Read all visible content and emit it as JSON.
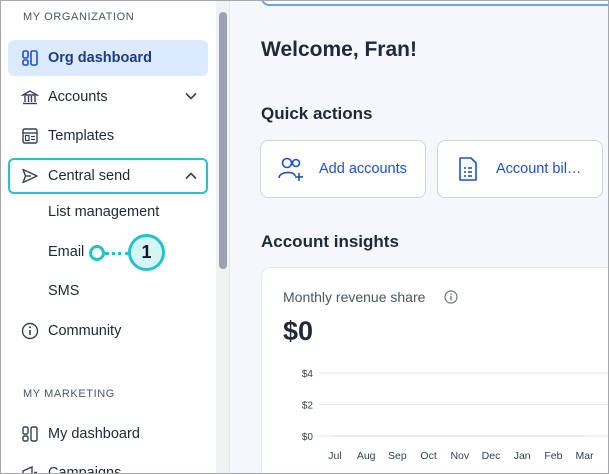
{
  "sidebar": {
    "section1": "MY ORGANIZATION",
    "org_dashboard": "Org dashboard",
    "accounts": "Accounts",
    "templates": "Templates",
    "central_send": "Central send",
    "list_management": "List management",
    "email": "Email",
    "sms": "SMS",
    "community": "Community",
    "section2": "MY MARKETING",
    "my_dashboard": "My dashboard",
    "campaigns": "Campaigns"
  },
  "main": {
    "welcome": "Welcome, Fran!",
    "quick_actions": "Quick actions",
    "add_accounts": "Add accounts",
    "account_billing": "Account bil…",
    "account_insights": "Account insights",
    "monthly_revenue": "Monthly revenue share",
    "revenue_value": "$0"
  },
  "callout": {
    "number": "1"
  },
  "colors": {
    "accent": "#22c3c9",
    "active_bg": "#dbeafe",
    "link": "#1d4ed8"
  },
  "chart_data": {
    "type": "line",
    "categories": [
      "Jul",
      "Aug",
      "Sep",
      "Oct",
      "Nov",
      "Dec",
      "Jan",
      "Feb",
      "Mar"
    ],
    "series": [
      {
        "values": [
          0,
          0,
          0,
          0,
          0,
          0,
          0,
          0,
          0
        ]
      }
    ],
    "yticks": [
      "$4",
      "$2",
      "$0"
    ],
    "ylim": [
      0,
      4
    ],
    "grid": true
  }
}
